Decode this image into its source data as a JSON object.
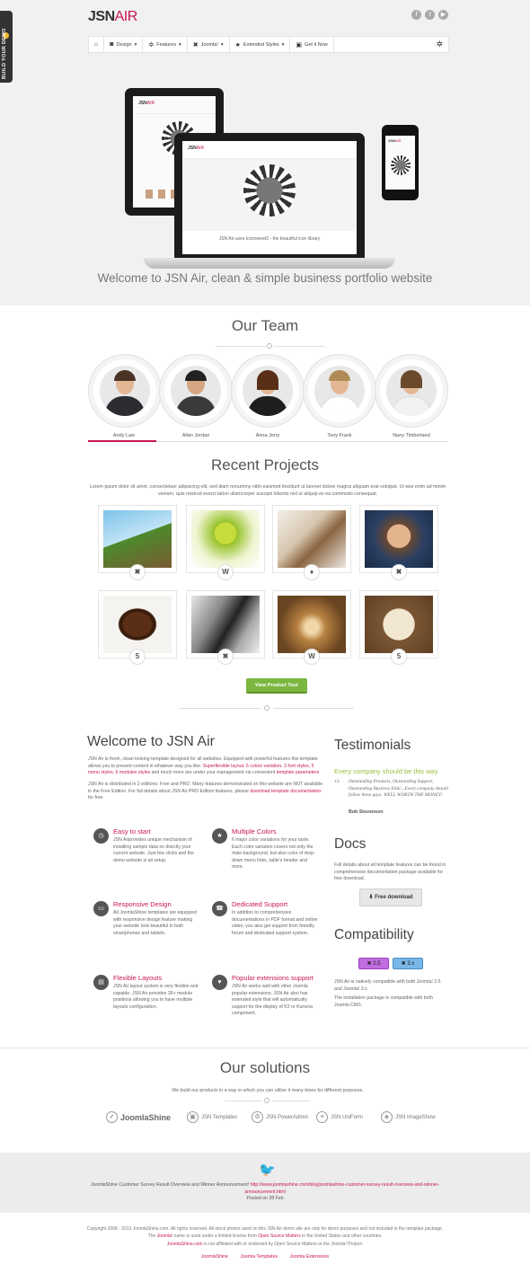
{
  "header": {
    "logo_main": "JSN",
    "logo_accent": "AIR",
    "build_tab": "BUILD YOUR DEMO",
    "social_icons": [
      "facebook-icon",
      "twitter-icon",
      "youtube-icon"
    ],
    "menu": [
      {
        "icon": "home-icon",
        "label": ""
      },
      {
        "icon": "camera-icon",
        "label": "Design"
      },
      {
        "icon": "gear-icon",
        "label": "Features"
      },
      {
        "icon": "joomla-icon",
        "label": "Joomla!"
      },
      {
        "icon": "star-icon",
        "label": "Extended Styles"
      },
      {
        "icon": "bag-icon",
        "label": "Get it Now"
      }
    ]
  },
  "hero": {
    "screen_caption": "JSN Air uses Iconsweet2 - the beautiful icon library",
    "welcome": "Welcome to JSN Air, clean & simple business portfolio website"
  },
  "team": {
    "title": "Our Team",
    "members": [
      "Andy Law",
      "Allan Jordan",
      "Anna Jerry",
      "Tony Frank",
      "Nany Timberland"
    ]
  },
  "projects": {
    "title": "Recent Projects",
    "intro": "Lorem ipsum dolor sit amet, consectetuer adipiscing elit, sed diam nonummy nibh euismod tincidunt ut laoreet dolore magna aliquam erat volutpat. Ut wisi enim ad minim veniam, quis nostrud exerci tation ullamcorper suscipit lobortis nisl ut aliquip ex ea commodo consequat.",
    "items": [
      {
        "badge": "✖",
        "badge_name": "joomla-icon"
      },
      {
        "badge": "W",
        "badge_name": "wordpress-icon"
      },
      {
        "badge": "♦",
        "badge_name": "drupal-icon"
      },
      {
        "badge": "✖",
        "badge_name": "joomla-icon"
      },
      {
        "badge": "5",
        "badge_name": "html5-icon"
      },
      {
        "badge": "✖",
        "badge_name": "joomla-icon"
      },
      {
        "badge": "W",
        "badge_name": "wordpress-icon"
      },
      {
        "badge": "5",
        "badge_name": "html5-icon"
      }
    ],
    "button": "View Product Tour"
  },
  "about": {
    "title": "Welcome to JSN Air",
    "p1_a": "JSN Air is fresh, clean looking template designed for all websites. Equipped with powerful features this template allows you to present content in whatever way you like.",
    "p1_red": "Superflexible layout, 6 colors variation, 3 font styles, 5 menu styles, 6 modules styles",
    "p1_b": "and much more are under your management via convenient",
    "p1_red2": "template parameters",
    "p2_a": "JSN Air is distributed in 2 editions: Free and PRO. Many features demonstrated on this website are NOT available in the Free Edition. For full details about JSN Air PRO Edition features, please",
    "p2_red": "download template documentation",
    "p2_b": "for free.",
    "features": [
      {
        "icon": "clock-icon",
        "glyph": "◷",
        "title": "Easy to start",
        "desc": "JSN Airprovides unique mechanism of installing sample data on directly your current website. Just few clicks and the demo website is all setup."
      },
      {
        "icon": "star-icon",
        "glyph": "★",
        "title": "Multiple Colors",
        "desc": "6 major color variations for your taste. Each color variation covers not only the main background, but also color of drop-down menu links, table's header and more."
      },
      {
        "icon": "monitor-icon",
        "glyph": "▭",
        "title": "Responsive Design",
        "desc": "All JoomlaShine templates are equipped with responsive design feature making your website look beautiful in both smartphones and tablets."
      },
      {
        "icon": "phone-icon",
        "glyph": "☎",
        "title": "Dedicated Support",
        "desc": "In addition to comprehensive documentations in PDF format and online video, you also get support from friendly forum and dedicated support system."
      },
      {
        "icon": "layout-icon",
        "glyph": "▤",
        "title": "Flexible Layouts",
        "desc": "JSN Air layout system is very flexible and capable. JSN Air provides 36+ module positions allowing you to have multiple layouts configuration."
      },
      {
        "icon": "heart-icon",
        "glyph": "♥",
        "title": "Popular extensions support",
        "desc": "JSN Air works well with other Joomla popular extensions. JSN Air also has extended style that will automatically support for the display of K2 or Kunena component."
      }
    ]
  },
  "sidebar": {
    "testimonials_title": "Testimonials",
    "quote_heading": "Every company should be this way",
    "quote": "Outstanding Products, Outstanding Support, Outstanding Business Ethic...Every company should follow these guys. WELL WORTH THE MONEY!",
    "quote_author": "Bob Stevenson",
    "docs_title": "Docs",
    "docs_text": "Full details about all template features can be found in comprehensive documentation package available for free download.",
    "download_label": "Free download",
    "compat_title": "Compatibility",
    "compat_badges": [
      "2.5",
      "3.x"
    ],
    "compat_text1": "JSN Air is natively compatible with both Joomla! 2.5 and Joomla! 3.x.",
    "compat_text2": "The installation package is compatible with both Joomla CMS."
  },
  "solutions": {
    "title": "Our solutions",
    "subtitle": "We build our products in a way in which you can utilize it many times for different purposes.",
    "items": [
      {
        "icon": "joomlashine-icon",
        "glyph": "✓",
        "label": "JoomlaShine"
      },
      {
        "icon": "templates-icon",
        "glyph": "▣",
        "label": "JSN Templates"
      },
      {
        "icon": "poweradmin-icon",
        "glyph": "⚙",
        "label": "JSN PowerAdmin"
      },
      {
        "icon": "uniform-icon",
        "glyph": "≡",
        "label": "JSN UniForm"
      },
      {
        "icon": "imageshow-icon",
        "glyph": "◈",
        "label": "JSN ImageShow"
      }
    ]
  },
  "tweet": {
    "text": "JoomlaShine Customer Survey Result Overview and Winner Announcement!",
    "link": "http://www.joomlashine.com/blog/joomlashine-customer-survey-result-overview-and-winner-announcement.html",
    "posted": "Posted on 28 Feb"
  },
  "footer": {
    "line1": "Copyright 2008 - 2013 JoomlaShine.com. All rights reserved. All stock photos used on this JSN Air demo site are only for demo purposes and not included in the template package.",
    "line2_a": "The",
    "line2_red": "Joomla!",
    "line2_b": "name is used under a limited license from",
    "line2_red2": "Open Source Matters",
    "line2_c": "in the United States and other countries.",
    "line3_red": "JoomlaShine.com",
    "line3_b": "is not affiliated with or endorsed by Open Source Matters or the Joomla! Project.",
    "links": [
      "JoomlaShine",
      "Joomla Templates",
      "Joomla Extensions"
    ]
  },
  "colors": {
    "accent": "#c8174e",
    "green": "#7cb740",
    "band": "#f1f1f1"
  }
}
